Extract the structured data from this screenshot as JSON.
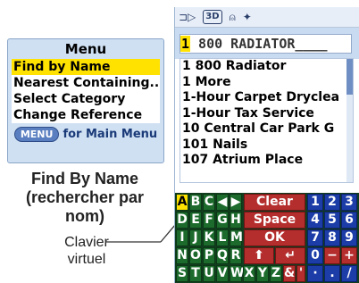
{
  "menu": {
    "title": "Menu",
    "items": [
      {
        "label": "Find by Name",
        "selected": true
      },
      {
        "label": "Nearest Containing..."
      },
      {
        "label": "Select Category"
      },
      {
        "label": "Change Reference"
      }
    ],
    "footer_key": "MENU",
    "footer_text": "for Main Menu"
  },
  "caption": {
    "line1": "Find By Name",
    "line2": "(rechercher par",
    "line3": "nom)"
  },
  "keyboard_label": {
    "line1": "Clavier",
    "line2": "virtuel"
  },
  "device": {
    "status_icons": [
      "route-icon",
      "3d-icon",
      "bell-icon",
      "lightbulb-icon"
    ],
    "status_3d": "3D",
    "search": {
      "cursor_char": "1",
      "text": " 800 RADIATOR____"
    },
    "results": [
      "1 800 Radiator",
      "1 More",
      "1-Hour Carpet Dryclea",
      "1-Hour Tax Service",
      "10 Central Car Park G",
      "101 Nails",
      "107 Atrium Place"
    ],
    "keyboard": {
      "rows": [
        [
          "A",
          "B",
          "C",
          "◀",
          "▶"
        ],
        [
          "D",
          "E",
          "F",
          "G",
          "H"
        ],
        [
          "I",
          "J",
          "K",
          "L",
          "M"
        ],
        [
          "N",
          "O",
          "P",
          "Q",
          "R"
        ],
        [
          "S",
          "T",
          "U",
          "V",
          "W",
          "X",
          "Y",
          "Z",
          "&"
        ]
      ],
      "actions": [
        "Clear",
        "Space",
        "OK"
      ],
      "extra_actions": [
        "⬆",
        "↵",
        "'",
        "-",
        ","
      ],
      "digits": [
        [
          "1",
          "2",
          "3"
        ],
        [
          "4",
          "5",
          "6"
        ],
        [
          "7",
          "8",
          "9"
        ],
        [
          "0",
          "−",
          "+"
        ],
        [
          "·",
          ".",
          "/"
        ]
      ],
      "selected_key": "A",
      "colors": {
        "letters": "#1c6b2d",
        "actions": "#b52e2e",
        "digits": "#1c3da8",
        "selected": "#ffe200"
      }
    }
  }
}
